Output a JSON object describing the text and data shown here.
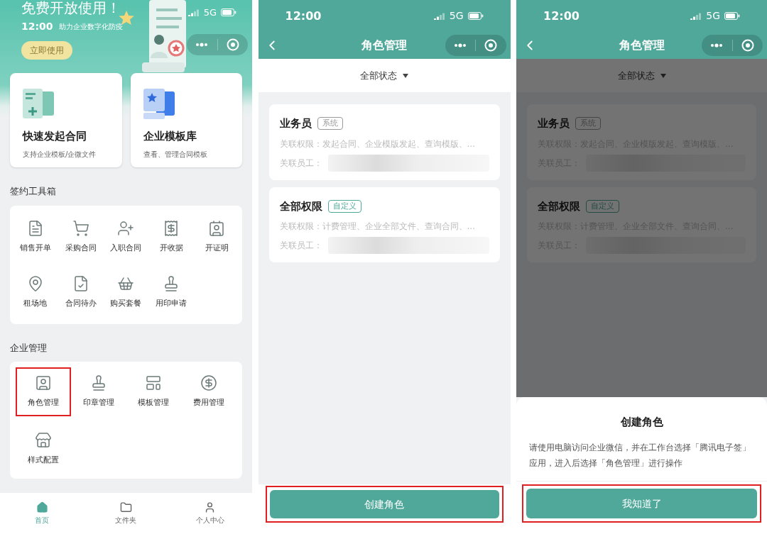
{
  "home": {
    "status_time": "12:00",
    "network": "5G",
    "banner": {
      "title": "免费开放使用！",
      "subtitle": "助力企业数字化防疫",
      "button": "立即使用"
    },
    "feature_cards": [
      {
        "title": "快速发起合同",
        "subtitle": "支持企业模板/企微文件"
      },
      {
        "title": "企业模板库",
        "subtitle": "查看、管理合同模板"
      }
    ],
    "toolbox": {
      "title": "签约工具箱",
      "items": [
        {
          "label": "销售开单",
          "highlighted": false
        },
        {
          "label": "采购合同",
          "highlighted": false
        },
        {
          "label": "入职合同",
          "highlighted": false
        },
        {
          "label": "开收据",
          "highlighted": false
        },
        {
          "label": "开证明",
          "highlighted": false
        },
        {
          "label": "租场地",
          "highlighted": false
        },
        {
          "label": "合同待办",
          "highlighted": false
        },
        {
          "label": "购买套餐",
          "highlighted": false
        },
        {
          "label": "用印申请",
          "highlighted": false
        }
      ]
    },
    "management": {
      "title": "企业管理",
      "items": [
        {
          "label": "角色管理",
          "highlighted": true
        },
        {
          "label": "印章管理",
          "highlighted": false
        },
        {
          "label": "模板管理",
          "highlighted": false
        },
        {
          "label": "费用管理",
          "highlighted": false
        },
        {
          "label": "样式配置",
          "highlighted": false
        }
      ]
    },
    "tab_bar": [
      {
        "label": "首页",
        "selected": true
      },
      {
        "label": "文件夹",
        "selected": false
      },
      {
        "label": "个人中心",
        "selected": false
      }
    ]
  },
  "roles_screen": {
    "status_time": "12:00",
    "network": "5G",
    "title": "角色管理",
    "filter": "全部状态",
    "roles": [
      {
        "name": "业务员",
        "tag": "系统",
        "color": "#999999",
        "permissions_label": "关联权限：",
        "permissions": "发起合同、企业模版发起、查询模版、...",
        "employees_label": "关联员工："
      },
      {
        "name": "全部权限",
        "tag": "自定义",
        "color": "#4fa89a",
        "permissions_label": "关联权限：",
        "permissions": "计费管理、企业全部文件、查询合同、...",
        "employees_label": "关联员工："
      }
    ],
    "create_button": {
      "label": "创建角色",
      "highlighted": true
    }
  },
  "dialog_screen": {
    "status_time": "12:00",
    "network": "5G",
    "title": "角色管理",
    "filter": "全部状态",
    "roles": [
      {
        "name": "业务员",
        "tag": "系统",
        "color": "#454545",
        "permissions_label": "关联权限：",
        "permissions": "发起合同、企业模版发起、查询模版、...",
        "employees_label": "关联员工："
      },
      {
        "name": "全部权限",
        "tag": "自定义",
        "color": "#244c45",
        "permissions_label": "关联权限：",
        "permissions": "计费管理、企业全部文件、查询合同、...",
        "employees_label": "关联员工："
      }
    ],
    "dialog": {
      "title": "创建角色",
      "message": "请使用电脑访问企业微信，并在工作台选择「腾讯电子签」应用，进入后选择「角色管理」进行操作",
      "button": {
        "label": "我知道了",
        "highlighted": true
      }
    }
  }
}
